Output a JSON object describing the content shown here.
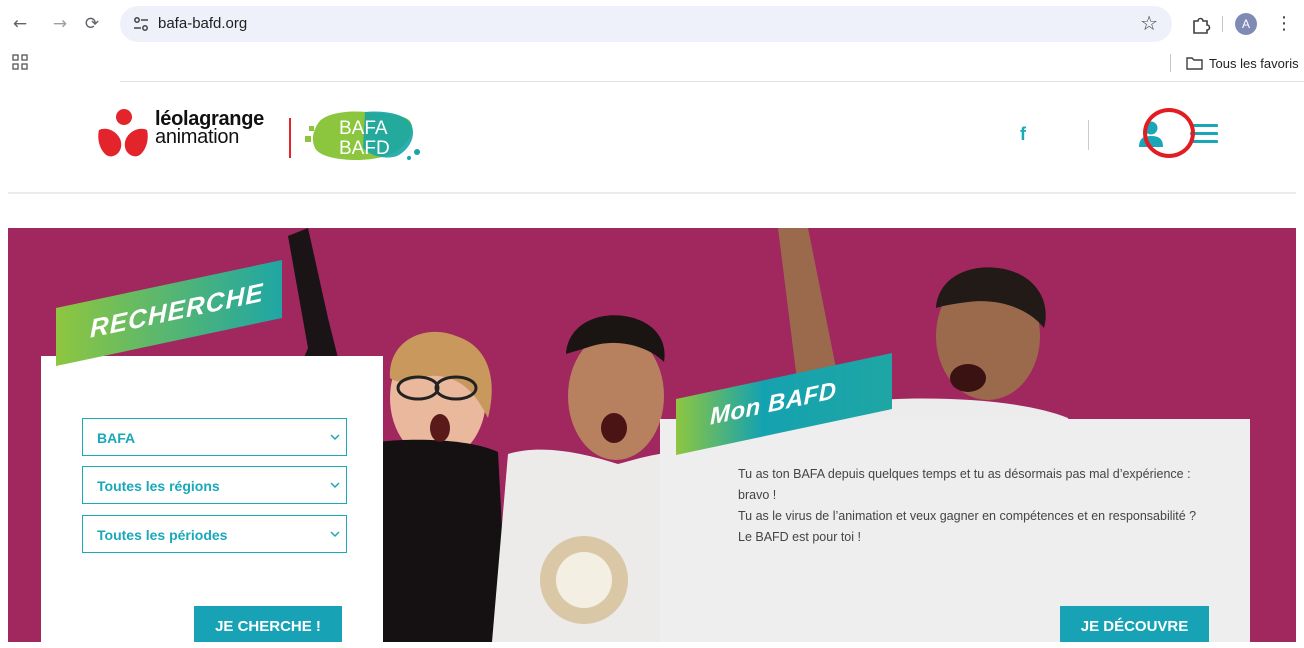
{
  "browser": {
    "url": "bafa-bafd.org",
    "profile_initial": "A",
    "bookmarks_folder": "Tous les favoris",
    "icons": [
      "back-arrow-icon",
      "forward-arrow-icon",
      "reload-icon",
      "site-settings-icon",
      "star-icon",
      "extensions-icon",
      "kebab-menu-icon",
      "apps-grid-icon",
      "folder-icon"
    ]
  },
  "header": {
    "brand_line1": "léolagrange",
    "brand_line2": "animation",
    "bafa_logo_line1": "BAFA",
    "bafa_logo_line2": "BAFD",
    "facebook_label": "f",
    "accent_color": "#19a7b8",
    "brand_red": "#e3242b"
  },
  "search": {
    "ribbon_label": "RECHERCHE",
    "selects": [
      {
        "value": "BAFA"
      },
      {
        "value": "Toutes les régions"
      },
      {
        "value": "Toutes les périodes"
      }
    ],
    "submit_label": "JE CHERCHE !"
  },
  "bafd": {
    "ribbon_label": "Mon BAFD",
    "text_line1": "Tu as ton BAFA depuis quelques temps et tu as désormais pas mal d’expérience : bravo !",
    "text_line2": "Tu as le virus de l’animation et veux gagner en compétences et en responsabilité ? Le BAFD est pour toi !",
    "cta_label": "JE DÉCOUVRE"
  },
  "hero": {
    "background_color": "#a0285f"
  }
}
